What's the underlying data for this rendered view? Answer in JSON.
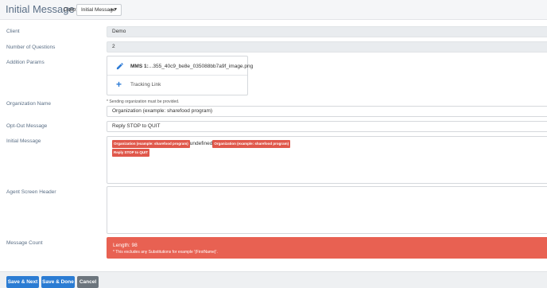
{
  "header": {
    "title": "Initial Message",
    "goto_label": "Goto:",
    "goto_value": "Initial Message",
    "goto_caret": "▲▼"
  },
  "fields": {
    "client": {
      "label": "Client",
      "value": "Demo"
    },
    "num_questions": {
      "label": "Number of Questions",
      "value": "2"
    },
    "addition_params": {
      "label": "Addition Params",
      "mms_label": "MMS 1:",
      "mms_file": "...355_40c9_be8e_035088bb7a9f_image.png",
      "tracking_link": "Tracking Link"
    },
    "org_name": {
      "label": "Organization Name",
      "note": "* Sending organization must be provided.",
      "value": "Organization (example: sharefood program)"
    },
    "opt_out": {
      "label": "Opt-Out Message",
      "value": "Reply STOP to QUIT"
    },
    "initial_message": {
      "label": "Initial Message",
      "chip1": "Organization (example: sharefood program)",
      "middle_text": "undefined",
      "chip2": "Organization (example: sharefood program)",
      "chip3": "Reply STOP to QUIT"
    },
    "agent_header": {
      "label": "Agent Screen Header",
      "value": ""
    },
    "message_count": {
      "label": "Message Count",
      "length": "Length: 98",
      "note": "* This excludes any Substitutions for example '{FirstName}'."
    }
  },
  "footer": {
    "save_next": "Save & Next",
    "save_done": "Save & Done",
    "cancel": "Cancel"
  },
  "colors": {
    "primary": "#2b7cd3",
    "danger": "#e86152",
    "label": "#5b6f86"
  }
}
